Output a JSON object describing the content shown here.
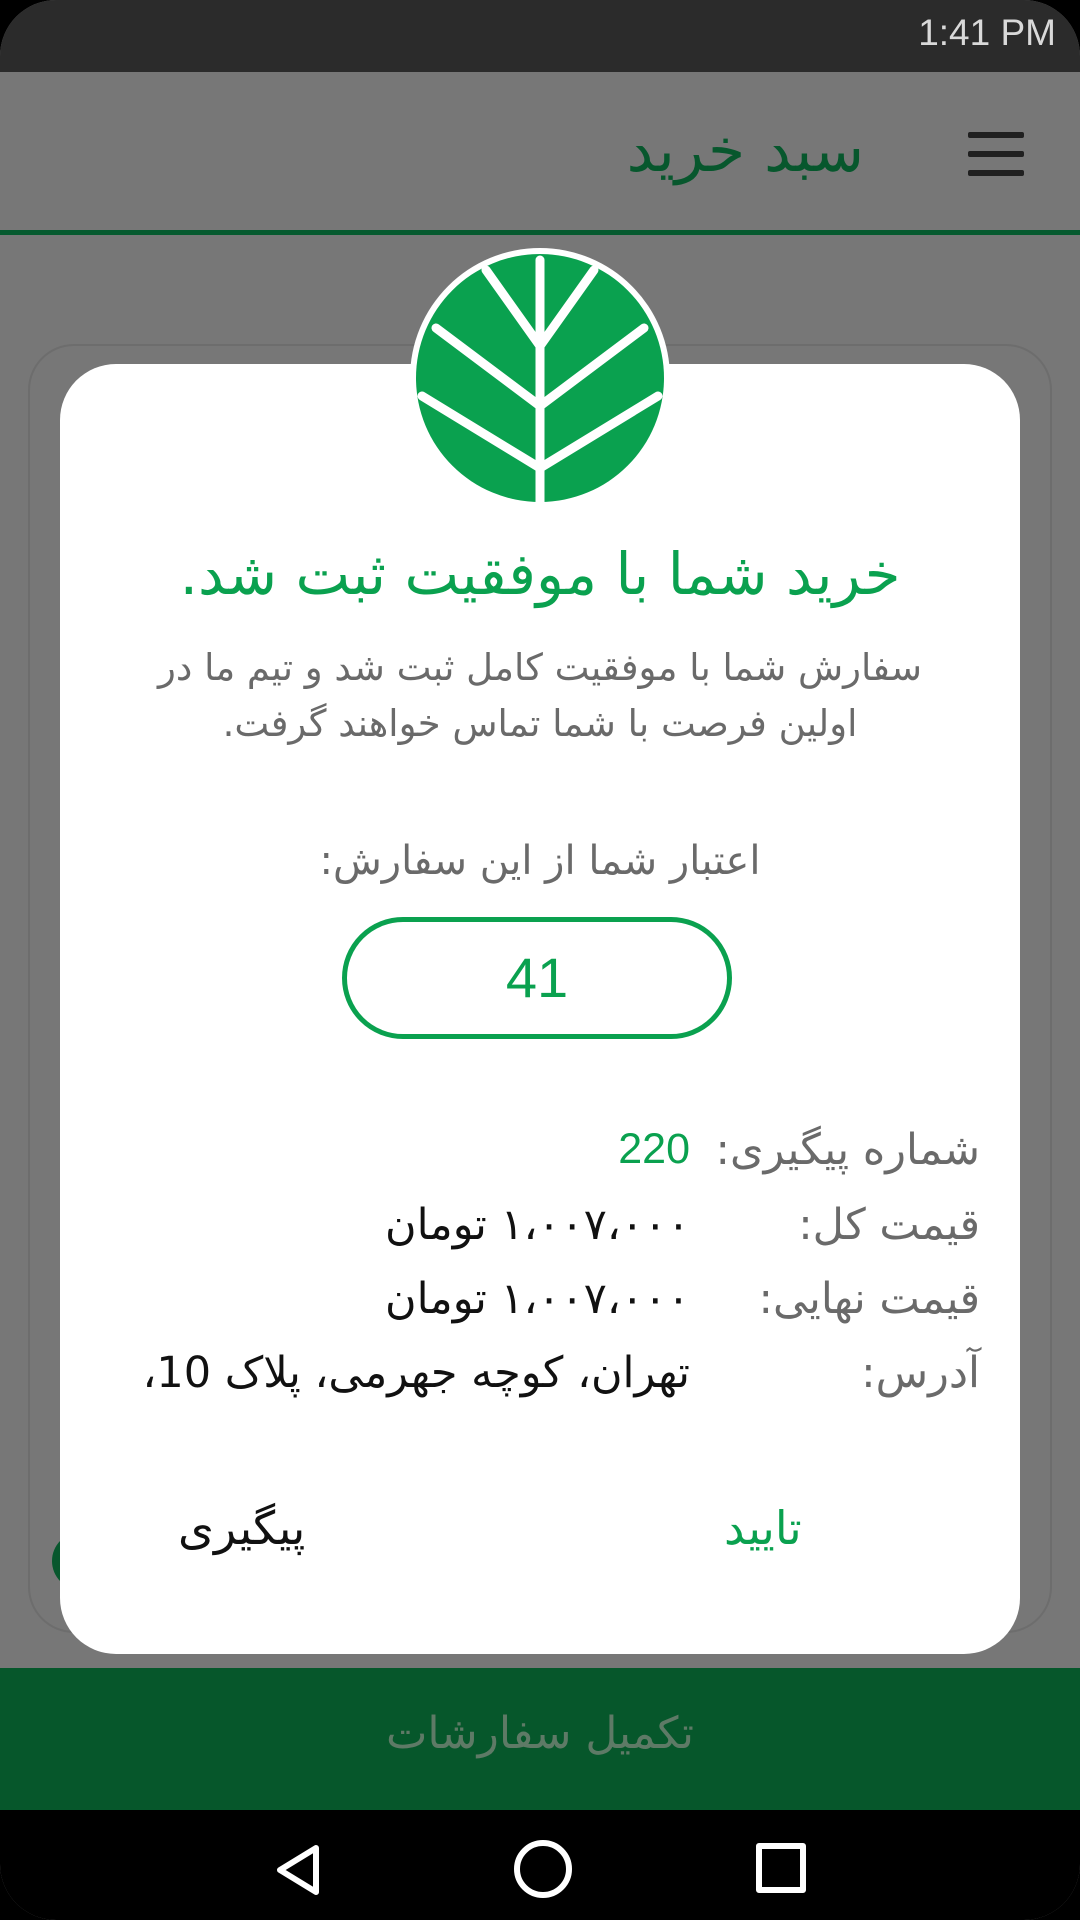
{
  "status_bar": {
    "time": "1:41 PM"
  },
  "app_bar": {
    "title": "سبد خرید"
  },
  "bottom_bar": {
    "label": "تکمیل سفارشات"
  },
  "dialog": {
    "title": "خرید شما با موفقیت ثبت شد.",
    "message": "سفارش شما با موفقیت کامل ثبت شد و تیم ما در اولین فرصت با شما تماس خواهند گرفت.",
    "credit_label": "اعتبار شما از این سفارش:",
    "credit_value": "41",
    "details": {
      "tracking_label": "شماره پیگیری:",
      "tracking_value": "220",
      "total_label": "قیمت کل:",
      "total_value": "۱،۰۰۷،۰۰۰ تومان",
      "final_label": "قیمت نهایی:",
      "final_value": "۱،۰۰۷،۰۰۰ تومان",
      "address_label": "آدرس:",
      "address_value": "تهران، کوچه جهرمی، پلاک 10،"
    },
    "buttons": {
      "confirm": "تایید",
      "track": "پیگیری"
    }
  },
  "colors": {
    "primary_green": "#0aa14f",
    "dark_green": "#06572b",
    "scrim_gray": "#777777"
  },
  "icons": {
    "logo": "leaf-logo-icon",
    "menu": "hamburger-menu-icon",
    "back": "back-icon",
    "home": "home-icon",
    "recents": "recents-icon"
  }
}
